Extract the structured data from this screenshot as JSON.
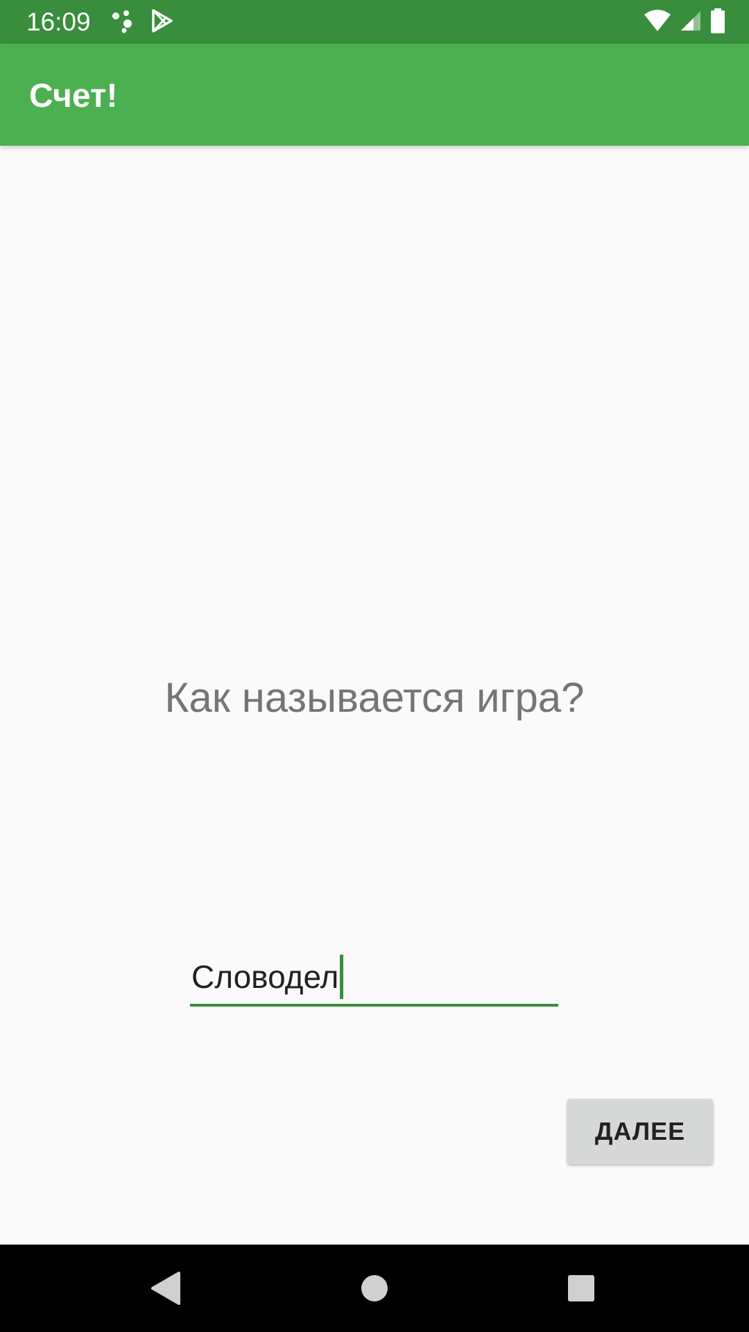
{
  "status_bar": {
    "time": "16:09",
    "left_icons": [
      "assistant-icon",
      "play-store-icon"
    ],
    "right_icons": [
      "wifi-icon",
      "cell-signal-icon",
      "battery-icon"
    ]
  },
  "app_bar": {
    "title": "Счет!",
    "color": "#4caf50"
  },
  "main": {
    "question": "Как называется игра?",
    "name_input": {
      "value": "Словодел",
      "placeholder": ""
    },
    "next_button_label": "ДАЛЕЕ"
  },
  "nav_bar": {
    "buttons": [
      "back-icon",
      "home-icon",
      "recents-icon"
    ]
  },
  "colors": {
    "status_bar": "#388e3c",
    "accent": "#388e3c",
    "background": "#fafafa",
    "button": "#d6d7d7"
  }
}
